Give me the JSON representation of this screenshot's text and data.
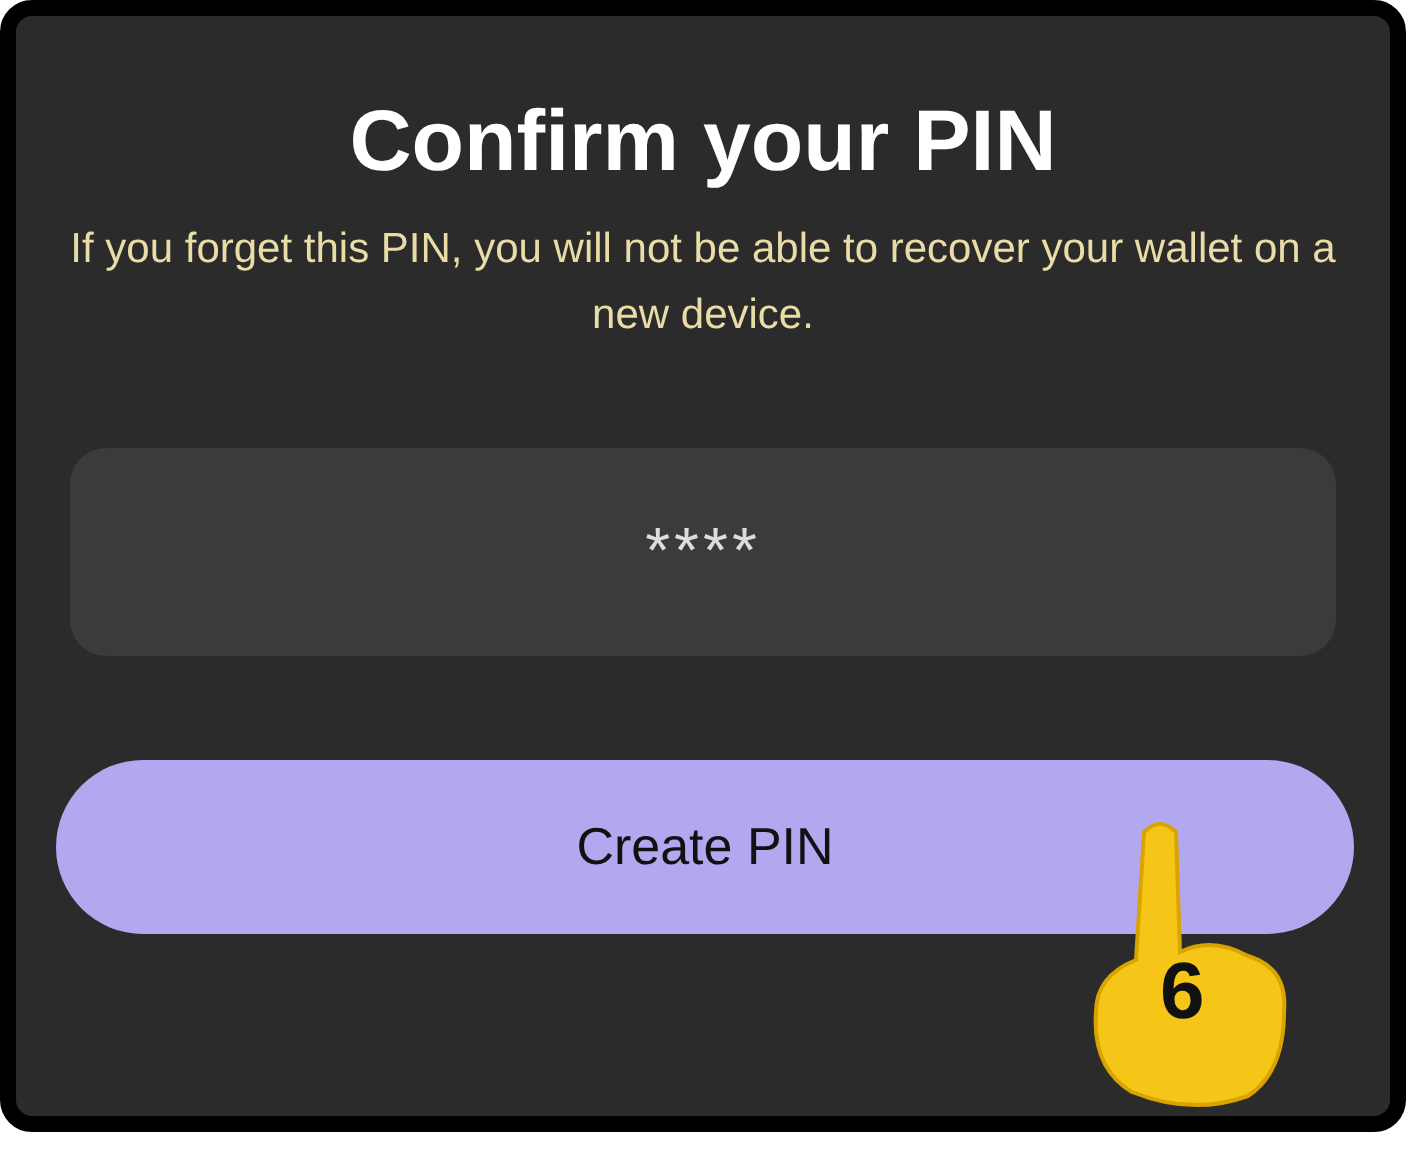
{
  "title": "Confirm your PIN",
  "subtitle": "If you forget this PIN, you will not be able to recover your wallet on a new device.",
  "pin_field": {
    "value": "****"
  },
  "button": {
    "label": "Create PIN"
  },
  "step_marker": {
    "number": "6"
  }
}
